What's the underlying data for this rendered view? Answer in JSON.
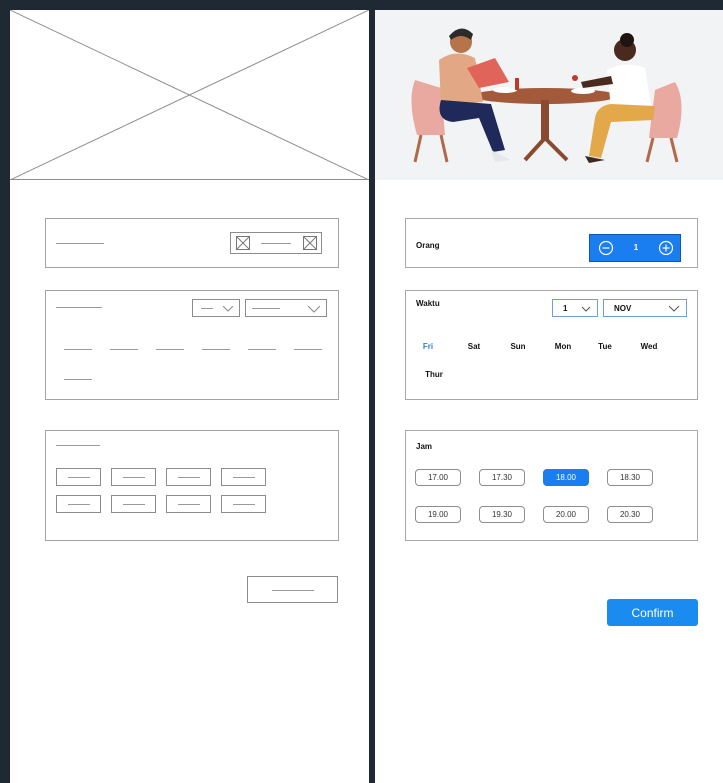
{
  "booking": {
    "guests_label": "Orang",
    "guests_count": "1",
    "time_label": "Waktu",
    "date_day": "1",
    "date_month": "NOV",
    "days": [
      "Fri",
      "Sat",
      "Sun",
      "Mon",
      "Tue",
      "Wed",
      "Thur"
    ],
    "selected_day": "Fri",
    "hour_label": "Jam",
    "times": [
      "17.00",
      "17.30",
      "18.00",
      "18.30",
      "19.00",
      "19.30",
      "20.00",
      "20.30"
    ],
    "selected_time": "18.00",
    "confirm_label": "Confirm"
  },
  "colors": {
    "accent": "#1a7ef0",
    "frame": "#1f2933",
    "wireframe_stroke": "#a3a3a3"
  },
  "icons": {
    "hero": "dining-couple-illustration",
    "decrement": "minus-circle-icon",
    "increment": "plus-circle-icon",
    "dropdown": "chevron-down-icon"
  }
}
